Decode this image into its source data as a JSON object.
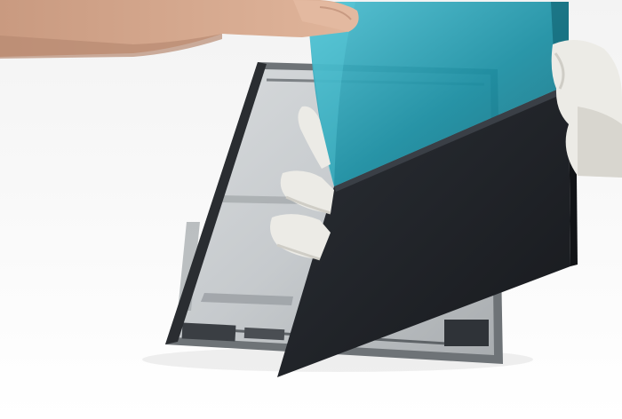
{
  "image": {
    "subject": "",
    "colors": {
      "background_top": "#f3f3f3",
      "background_bottom": "#ffffff",
      "film": "#1b8fa3",
      "film_highlight": "#4ec0d2",
      "panel": "#1f2227",
      "panel_edge": "#2f3339",
      "frame_metal": "#8d9297",
      "frame_inner": "#b8bcbf",
      "glove": "#ecebe6",
      "glove_shadow": "#cfcdc6",
      "skin": "#d6a98e",
      "skin_shadow": "#b88a72"
    }
  }
}
